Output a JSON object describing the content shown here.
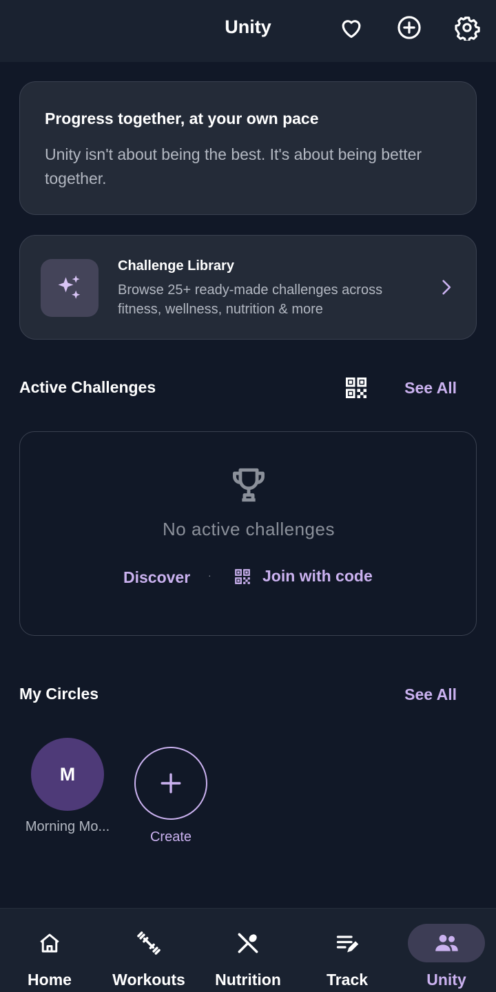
{
  "app_bar": {
    "title": "Unity",
    "icons": [
      "heart-icon",
      "add-circle-icon",
      "gear-icon"
    ]
  },
  "intro_card": {
    "title": "Progress together, at your own pace",
    "body": "Unity isn't about being the best. It's about being better together."
  },
  "challenge_library": {
    "title": "Challenge Library",
    "description": "Browse 25+ ready-made challenges across fitness, wellness, nutrition & more",
    "icon": "sparkles-icon"
  },
  "active_challenges": {
    "title": "Active Challenges",
    "see_all": "See All",
    "empty_text": "No active challenges",
    "discover_label": "Discover",
    "separator": "·",
    "join_label": "Join with code"
  },
  "my_circles": {
    "title": "My Circles",
    "see_all": "See All",
    "circles": [
      {
        "initial": "M",
        "name": "Morning Mo..."
      }
    ],
    "create_label": "Create"
  },
  "bottom_nav": {
    "items": [
      {
        "label": "Home",
        "icon": "home-icon"
      },
      {
        "label": "Workouts",
        "icon": "dumbbell-icon"
      },
      {
        "label": "Nutrition",
        "icon": "utensils-icon"
      },
      {
        "label": "Track",
        "icon": "edit-list-icon"
      },
      {
        "label": "Unity",
        "icon": "group-icon",
        "active": true
      }
    ]
  },
  "colors": {
    "background": "#111827",
    "surface": "#242b38",
    "accent": "#cbb2f0",
    "avatar": "#4e3a78"
  }
}
